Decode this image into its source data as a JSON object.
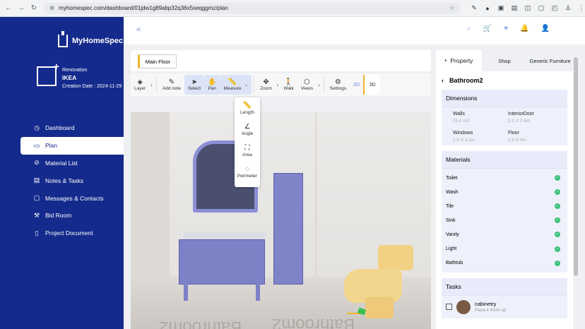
{
  "browser": {
    "url": "myhomespec.com/dashboard/01jdw1g89abp32q36x5seqggmz/plan"
  },
  "brand": {
    "name": "MyHomeSpec"
  },
  "project": {
    "type": "Renovation",
    "name": "IKEA",
    "created": "Creation Date : 2024-11-29"
  },
  "menu": [
    {
      "label": "Dashboard",
      "icon": "dashboard-icon",
      "glyph": "◷"
    },
    {
      "label": "Plan",
      "icon": "plan-icon",
      "glyph": "▭",
      "active": true
    },
    {
      "label": "Material List",
      "icon": "material-icon",
      "glyph": "⊘"
    },
    {
      "label": "Notes & Tasks",
      "icon": "notes-icon",
      "glyph": "▤"
    },
    {
      "label": "Messages & Contacts",
      "icon": "messages-icon",
      "glyph": "▢"
    },
    {
      "label": "Bid Room",
      "icon": "bid-icon",
      "glyph": "⚒"
    },
    {
      "label": "Project Document",
      "icon": "document-icon",
      "glyph": "▯"
    }
  ],
  "floor": {
    "label": "Main Floor"
  },
  "tools": {
    "layer": "Layer",
    "add_note": "Add note",
    "select": "Select",
    "pan": "Pan",
    "measure": "Measure",
    "zoom": "Zoom",
    "walk": "Walk",
    "views": "Views",
    "settings": "Settings",
    "view2d": "2D",
    "view3d": "3D"
  },
  "measure_menu": [
    "Length",
    "Angle",
    "Area",
    "Perimeter"
  ],
  "scene": {
    "floor_text": "Bathroom2"
  },
  "panel": {
    "tabs": [
      "Property",
      "Shop",
      "Generic Furniture"
    ],
    "room": "Bathroom2",
    "dimensions_title": "Dimensions",
    "dimensions": [
      {
        "k": "Walls",
        "v": "23.4 m2"
      },
      {
        "k": "InteriorDoor",
        "v": "2.2 X 0.9m"
      },
      {
        "k": "Windows",
        "v": "1.5 X 2.1m"
      },
      {
        "k": "Floor",
        "v": "1.9 X 4m"
      }
    ],
    "materials_title": "Materials",
    "materials": [
      "Toilet",
      "Wash",
      "Tile",
      "Sink",
      "Vanity",
      "Light",
      "Bathtub"
    ],
    "tasks_title": "Tasks",
    "task": {
      "name": "cabinetry",
      "sub": "Place it 40cm up"
    }
  }
}
